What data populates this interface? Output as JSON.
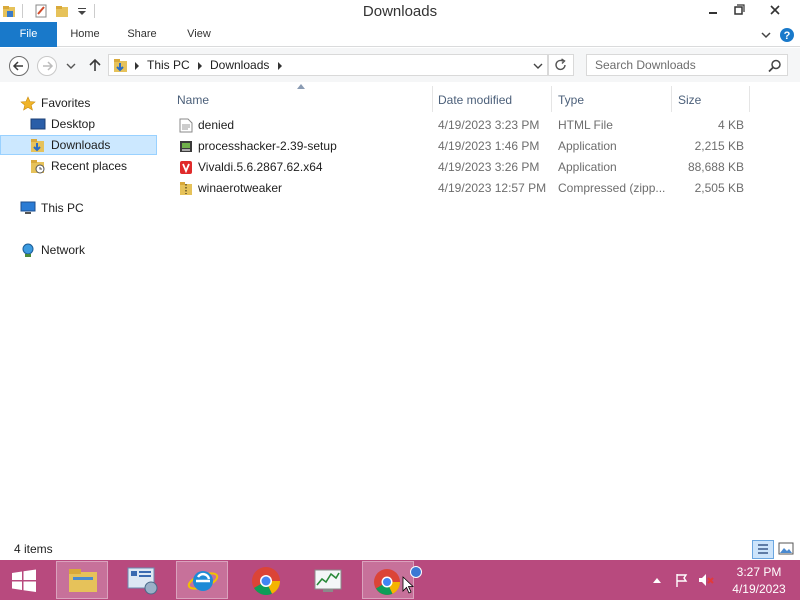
{
  "window": {
    "title": "Downloads",
    "controls": [
      "minimize",
      "maximize",
      "close"
    ]
  },
  "ribbon": {
    "tabs": [
      {
        "label": "File",
        "active": true
      },
      {
        "label": "Home"
      },
      {
        "label": "Share"
      },
      {
        "label": "View"
      }
    ]
  },
  "address": {
    "path": [
      "This PC",
      "Downloads"
    ],
    "search_placeholder": "Search Downloads"
  },
  "nav": {
    "favorites_label": "Favorites",
    "favorites": [
      {
        "label": "Desktop"
      },
      {
        "label": "Downloads",
        "selected": true
      },
      {
        "label": "Recent places"
      }
    ],
    "this_pc": "This PC",
    "network": "Network"
  },
  "table": {
    "columns": [
      "Name",
      "Date modified",
      "Type",
      "Size"
    ],
    "rows": [
      {
        "name": "denied",
        "date": "4/19/2023 3:23 PM",
        "type": "HTML File",
        "size": "4 KB",
        "icon": "html-file-icon"
      },
      {
        "name": "processhacker-2.39-setup",
        "date": "4/19/2023 1:46 PM",
        "type": "Application",
        "size": "2,215 KB",
        "icon": "app-icon"
      },
      {
        "name": "Vivaldi.5.6.2867.62.x64",
        "date": "4/19/2023 3:26 PM",
        "type": "Application",
        "size": "88,688 KB",
        "icon": "vivaldi-icon"
      },
      {
        "name": "winaerotweaker",
        "date": "4/19/2023 12:57 PM",
        "type": "Compressed (zipp...",
        "size": "2,505 KB",
        "icon": "zip-folder-icon"
      }
    ]
  },
  "status": {
    "item_count": "4 items"
  },
  "taskbar": {
    "clock_time": "3:27 PM",
    "clock_date": "4/19/2023",
    "accent": "#b84a7e"
  }
}
